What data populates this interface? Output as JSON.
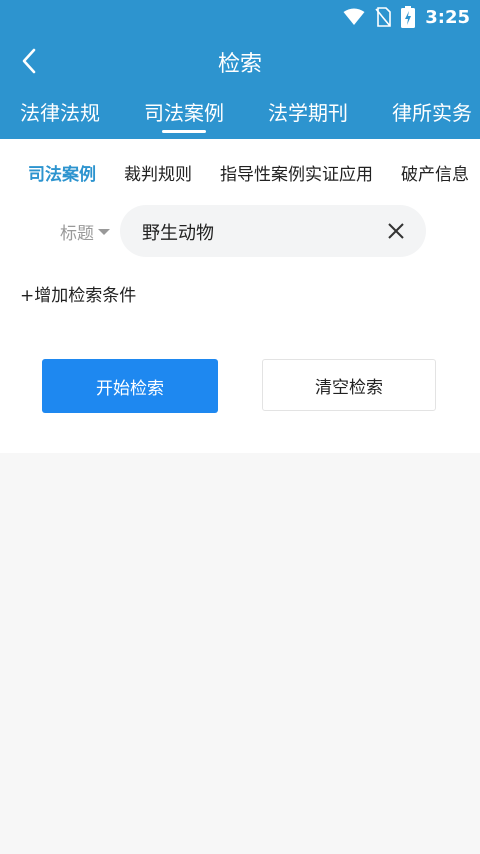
{
  "status_bar": {
    "time": "3:25",
    "icons": [
      "wifi-icon",
      "no-sim-icon",
      "battery-charging-icon"
    ]
  },
  "header": {
    "title": "检索",
    "back_icon": "chevron-left-icon",
    "tabs": [
      {
        "label": "法律法规",
        "active": false
      },
      {
        "label": "司法案例",
        "active": true
      },
      {
        "label": "法学期刊",
        "active": false
      },
      {
        "label": "律所实务",
        "active": false
      }
    ]
  },
  "sub_tabs": [
    {
      "label": "司法案例",
      "active": true
    },
    {
      "label": "裁判规则",
      "active": false
    },
    {
      "label": "指导性案例实证应用",
      "active": false
    },
    {
      "label": "破产信息",
      "active": false
    }
  ],
  "search": {
    "field_label": "标题",
    "value": "野生动物",
    "clear_icon": "close-icon"
  },
  "add_condition_label": "+增加检索条件",
  "buttons": {
    "start": "开始检索",
    "clear": "清空检索"
  },
  "colors": {
    "header_bg": "#2d94cf",
    "accent": "#2d94cf",
    "primary_button": "#1e88f0"
  }
}
